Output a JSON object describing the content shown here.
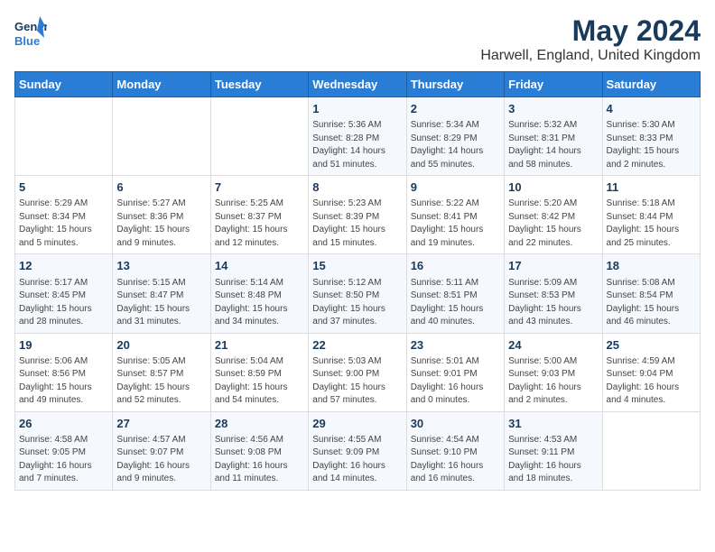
{
  "logo": {
    "line1": "General",
    "line2": "Blue"
  },
  "title": "May 2024",
  "subtitle": "Harwell, England, United Kingdom",
  "days_of_week": [
    "Sunday",
    "Monday",
    "Tuesday",
    "Wednesday",
    "Thursday",
    "Friday",
    "Saturday"
  ],
  "weeks": [
    [
      {
        "num": "",
        "info": ""
      },
      {
        "num": "",
        "info": ""
      },
      {
        "num": "",
        "info": ""
      },
      {
        "num": "1",
        "info": "Sunrise: 5:36 AM\nSunset: 8:28 PM\nDaylight: 14 hours\nand 51 minutes."
      },
      {
        "num": "2",
        "info": "Sunrise: 5:34 AM\nSunset: 8:29 PM\nDaylight: 14 hours\nand 55 minutes."
      },
      {
        "num": "3",
        "info": "Sunrise: 5:32 AM\nSunset: 8:31 PM\nDaylight: 14 hours\nand 58 minutes."
      },
      {
        "num": "4",
        "info": "Sunrise: 5:30 AM\nSunset: 8:33 PM\nDaylight: 15 hours\nand 2 minutes."
      }
    ],
    [
      {
        "num": "5",
        "info": "Sunrise: 5:29 AM\nSunset: 8:34 PM\nDaylight: 15 hours\nand 5 minutes."
      },
      {
        "num": "6",
        "info": "Sunrise: 5:27 AM\nSunset: 8:36 PM\nDaylight: 15 hours\nand 9 minutes."
      },
      {
        "num": "7",
        "info": "Sunrise: 5:25 AM\nSunset: 8:37 PM\nDaylight: 15 hours\nand 12 minutes."
      },
      {
        "num": "8",
        "info": "Sunrise: 5:23 AM\nSunset: 8:39 PM\nDaylight: 15 hours\nand 15 minutes."
      },
      {
        "num": "9",
        "info": "Sunrise: 5:22 AM\nSunset: 8:41 PM\nDaylight: 15 hours\nand 19 minutes."
      },
      {
        "num": "10",
        "info": "Sunrise: 5:20 AM\nSunset: 8:42 PM\nDaylight: 15 hours\nand 22 minutes."
      },
      {
        "num": "11",
        "info": "Sunrise: 5:18 AM\nSunset: 8:44 PM\nDaylight: 15 hours\nand 25 minutes."
      }
    ],
    [
      {
        "num": "12",
        "info": "Sunrise: 5:17 AM\nSunset: 8:45 PM\nDaylight: 15 hours\nand 28 minutes."
      },
      {
        "num": "13",
        "info": "Sunrise: 5:15 AM\nSunset: 8:47 PM\nDaylight: 15 hours\nand 31 minutes."
      },
      {
        "num": "14",
        "info": "Sunrise: 5:14 AM\nSunset: 8:48 PM\nDaylight: 15 hours\nand 34 minutes."
      },
      {
        "num": "15",
        "info": "Sunrise: 5:12 AM\nSunset: 8:50 PM\nDaylight: 15 hours\nand 37 minutes."
      },
      {
        "num": "16",
        "info": "Sunrise: 5:11 AM\nSunset: 8:51 PM\nDaylight: 15 hours\nand 40 minutes."
      },
      {
        "num": "17",
        "info": "Sunrise: 5:09 AM\nSunset: 8:53 PM\nDaylight: 15 hours\nand 43 minutes."
      },
      {
        "num": "18",
        "info": "Sunrise: 5:08 AM\nSunset: 8:54 PM\nDaylight: 15 hours\nand 46 minutes."
      }
    ],
    [
      {
        "num": "19",
        "info": "Sunrise: 5:06 AM\nSunset: 8:56 PM\nDaylight: 15 hours\nand 49 minutes."
      },
      {
        "num": "20",
        "info": "Sunrise: 5:05 AM\nSunset: 8:57 PM\nDaylight: 15 hours\nand 52 minutes."
      },
      {
        "num": "21",
        "info": "Sunrise: 5:04 AM\nSunset: 8:59 PM\nDaylight: 15 hours\nand 54 minutes."
      },
      {
        "num": "22",
        "info": "Sunrise: 5:03 AM\nSunset: 9:00 PM\nDaylight: 15 hours\nand 57 minutes."
      },
      {
        "num": "23",
        "info": "Sunrise: 5:01 AM\nSunset: 9:01 PM\nDaylight: 16 hours\nand 0 minutes."
      },
      {
        "num": "24",
        "info": "Sunrise: 5:00 AM\nSunset: 9:03 PM\nDaylight: 16 hours\nand 2 minutes."
      },
      {
        "num": "25",
        "info": "Sunrise: 4:59 AM\nSunset: 9:04 PM\nDaylight: 16 hours\nand 4 minutes."
      }
    ],
    [
      {
        "num": "26",
        "info": "Sunrise: 4:58 AM\nSunset: 9:05 PM\nDaylight: 16 hours\nand 7 minutes."
      },
      {
        "num": "27",
        "info": "Sunrise: 4:57 AM\nSunset: 9:07 PM\nDaylight: 16 hours\nand 9 minutes."
      },
      {
        "num": "28",
        "info": "Sunrise: 4:56 AM\nSunset: 9:08 PM\nDaylight: 16 hours\nand 11 minutes."
      },
      {
        "num": "29",
        "info": "Sunrise: 4:55 AM\nSunset: 9:09 PM\nDaylight: 16 hours\nand 14 minutes."
      },
      {
        "num": "30",
        "info": "Sunrise: 4:54 AM\nSunset: 9:10 PM\nDaylight: 16 hours\nand 16 minutes."
      },
      {
        "num": "31",
        "info": "Sunrise: 4:53 AM\nSunset: 9:11 PM\nDaylight: 16 hours\nand 18 minutes."
      },
      {
        "num": "",
        "info": ""
      }
    ]
  ]
}
